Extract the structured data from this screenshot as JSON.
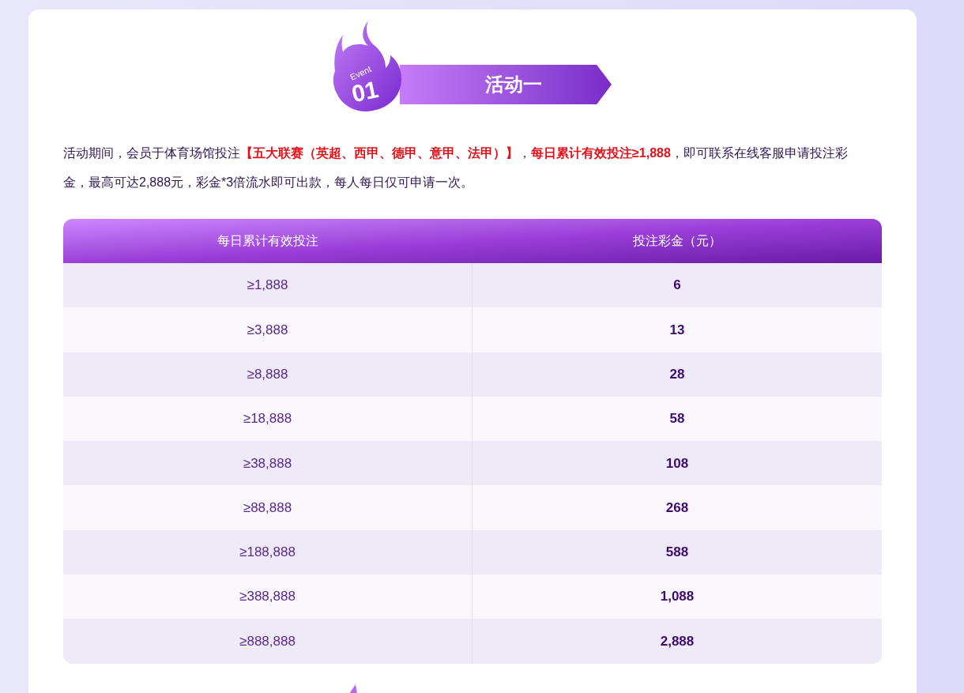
{
  "banner": {
    "badge_label": "Event",
    "badge_number": "01",
    "title": "活动一"
  },
  "description": "活动期间，会员于体育场馆投注**【五大联赛（英超、西甲、德甲、意甲、法甲）】**，**每日累计有效投注≥1,888**，即可联系在线客服申请投注彩金，最高可达2,888元，彩金*3倍流水即可出款，每人每日仅可申请一次。",
  "table": {
    "columns": [
      "每日累计有效投注",
      "投注彩金（元）"
    ],
    "rows": [
      [
        "≥1,888",
        "6"
      ],
      [
        "≥3,888",
        "13"
      ],
      [
        "≥8,888",
        "28"
      ],
      [
        "≥18,888",
        "58"
      ],
      [
        "≥38,888",
        "108"
      ],
      [
        "≥88,888",
        "268"
      ],
      [
        "≥188,888",
        "588"
      ],
      [
        "≥388,888",
        "1,088"
      ],
      [
        "≥888,888",
        "2,888"
      ]
    ]
  }
}
